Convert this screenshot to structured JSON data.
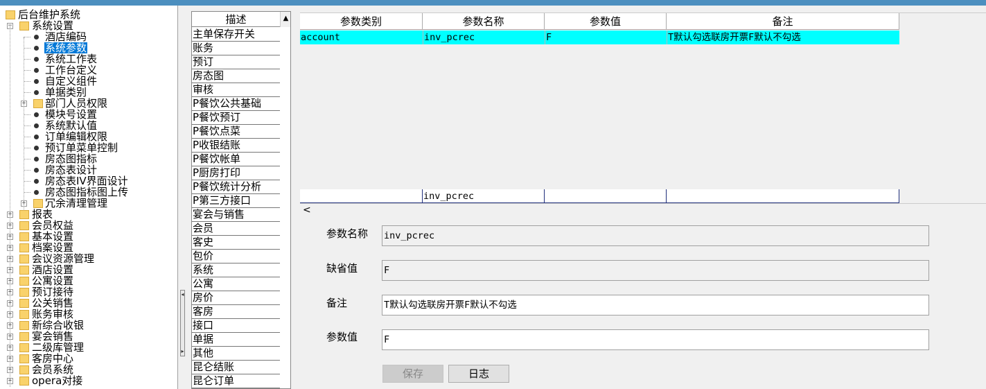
{
  "tree": {
    "items": [
      {
        "label": "后台维护系统",
        "level": 0,
        "type": "folder"
      },
      {
        "label": "系统设置",
        "level": 1,
        "type": "folder",
        "expanded": true
      },
      {
        "label": "酒店编码",
        "level": 2,
        "type": "leaf"
      },
      {
        "label": "系统参数",
        "level": 2,
        "type": "leaf",
        "selected": true
      },
      {
        "label": "系统工作表",
        "level": 2,
        "type": "leaf"
      },
      {
        "label": "工作台定义",
        "level": 2,
        "type": "leaf"
      },
      {
        "label": "自定义组件",
        "level": 2,
        "type": "leaf"
      },
      {
        "label": "单据类别",
        "level": 2,
        "type": "leaf"
      },
      {
        "label": "部门人员权限",
        "level": 2,
        "type": "folder",
        "expanded": false
      },
      {
        "label": "模块号设置",
        "level": 2,
        "type": "leaf"
      },
      {
        "label": "系统默认值",
        "level": 2,
        "type": "leaf"
      },
      {
        "label": "订单编辑权限",
        "level": 2,
        "type": "leaf"
      },
      {
        "label": "预订单菜单控制",
        "level": 2,
        "type": "leaf"
      },
      {
        "label": "房态图指标",
        "level": 2,
        "type": "leaf"
      },
      {
        "label": "房态表设计",
        "level": 2,
        "type": "leaf"
      },
      {
        "label": "房态表IV界面设计",
        "level": 2,
        "type": "leaf"
      },
      {
        "label": "房态图指标图上传",
        "level": 2,
        "type": "leaf"
      },
      {
        "label": "冗余清理管理",
        "level": 2,
        "type": "folder",
        "expanded": false
      },
      {
        "label": "报表",
        "level": 1,
        "type": "folder",
        "expanded": false
      },
      {
        "label": "会员权益",
        "level": 1,
        "type": "folder",
        "expanded": false
      },
      {
        "label": "基本设置",
        "level": 1,
        "type": "folder",
        "expanded": false
      },
      {
        "label": "档案设置",
        "level": 1,
        "type": "folder",
        "expanded": false
      },
      {
        "label": "会议资源管理",
        "level": 1,
        "type": "folder",
        "expanded": false
      },
      {
        "label": "酒店设置",
        "level": 1,
        "type": "folder",
        "expanded": false
      },
      {
        "label": "公寓设置",
        "level": 1,
        "type": "folder",
        "expanded": false
      },
      {
        "label": "预订接待",
        "level": 1,
        "type": "folder",
        "expanded": false
      },
      {
        "label": "公关销售",
        "level": 1,
        "type": "folder",
        "expanded": false
      },
      {
        "label": "账务审核",
        "level": 1,
        "type": "folder",
        "expanded": false
      },
      {
        "label": "新综合收银",
        "level": 1,
        "type": "folder",
        "expanded": false
      },
      {
        "label": "宴会销售",
        "level": 1,
        "type": "folder",
        "expanded": false
      },
      {
        "label": "二级库管理",
        "level": 1,
        "type": "folder",
        "expanded": false
      },
      {
        "label": "客房中心",
        "level": 1,
        "type": "folder",
        "expanded": false
      },
      {
        "label": "会员系统",
        "level": 1,
        "type": "folder",
        "expanded": false
      },
      {
        "label": "opera对接",
        "level": 1,
        "type": "folder",
        "expanded": false
      }
    ]
  },
  "desc_list": {
    "header": "描述",
    "items": [
      "主单保存开关",
      "账务",
      "预订",
      "房态图",
      "审核",
      "P餐饮公共基础",
      "P餐饮预订",
      "P餐饮点菜",
      "P收银结账",
      "P餐饮帐单",
      "P厨房打印",
      "P餐饮统计分析",
      "P第三方接口",
      "宴会与销售",
      "会员",
      "客史",
      "包价",
      "系统",
      "公寓",
      "房价",
      "客房",
      "接口",
      "单据",
      "其他",
      "昆仑结账",
      "昆仑订单"
    ]
  },
  "grid": {
    "columns": [
      "参数类别",
      "参数名称",
      "参数值",
      "备注"
    ],
    "rows": [
      {
        "category": "account",
        "name": "inv_pcrec",
        "value": "F",
        "remark": "T默认勾选联房开票F默认不勾选",
        "selected": true
      }
    ],
    "edit_row": {
      "category": "",
      "name": "inv_pcrec",
      "value": "",
      "remark": ""
    },
    "scroll_left": "<"
  },
  "form": {
    "name_label": "参数名称",
    "name_value": "inv_pcrec",
    "default_label": "缺省值",
    "default_value": "F",
    "remark_label": "备注",
    "remark_value": "T默认勾选联房开票F默认不勾选",
    "value_label": "参数值",
    "value_value": "F",
    "save_label": "保存",
    "log_label": "日志"
  },
  "colors": {
    "selection": "#0078d7",
    "row_highlight": "#00ffff",
    "folder": "#f9d26b",
    "titlebar": "#4c8fbf"
  }
}
